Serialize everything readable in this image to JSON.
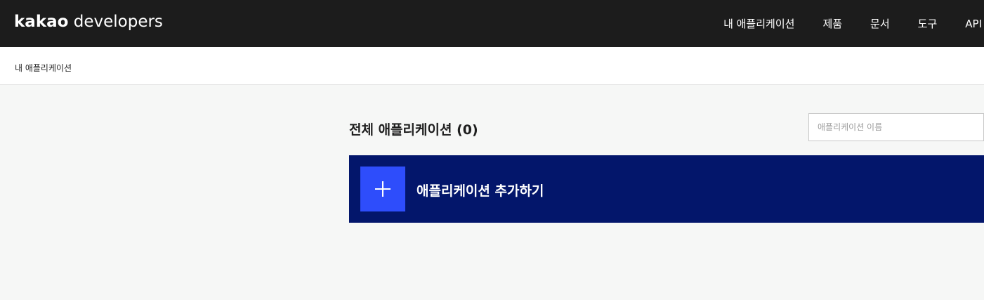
{
  "header": {
    "logo_brand": "kakao",
    "logo_suffix": "developers",
    "nav": [
      {
        "label": "내 애플리케이션"
      },
      {
        "label": "제품"
      },
      {
        "label": "문서"
      },
      {
        "label": "도구"
      },
      {
        "label": "API"
      }
    ]
  },
  "breadcrumb": {
    "current": "내 애플리케이션"
  },
  "main": {
    "title": "전체 애플리케이션 (0)",
    "search_placeholder": "애플리케이션 이름",
    "add_app_label": "애플리케이션 추가하기"
  },
  "colors": {
    "header_bg": "#1c1c1c",
    "add_app_bg": "#03166b",
    "plus_box_bg": "#2e4dfb",
    "page_bg": "#f6f7f6"
  },
  "icons": {
    "add": "plus-icon"
  }
}
